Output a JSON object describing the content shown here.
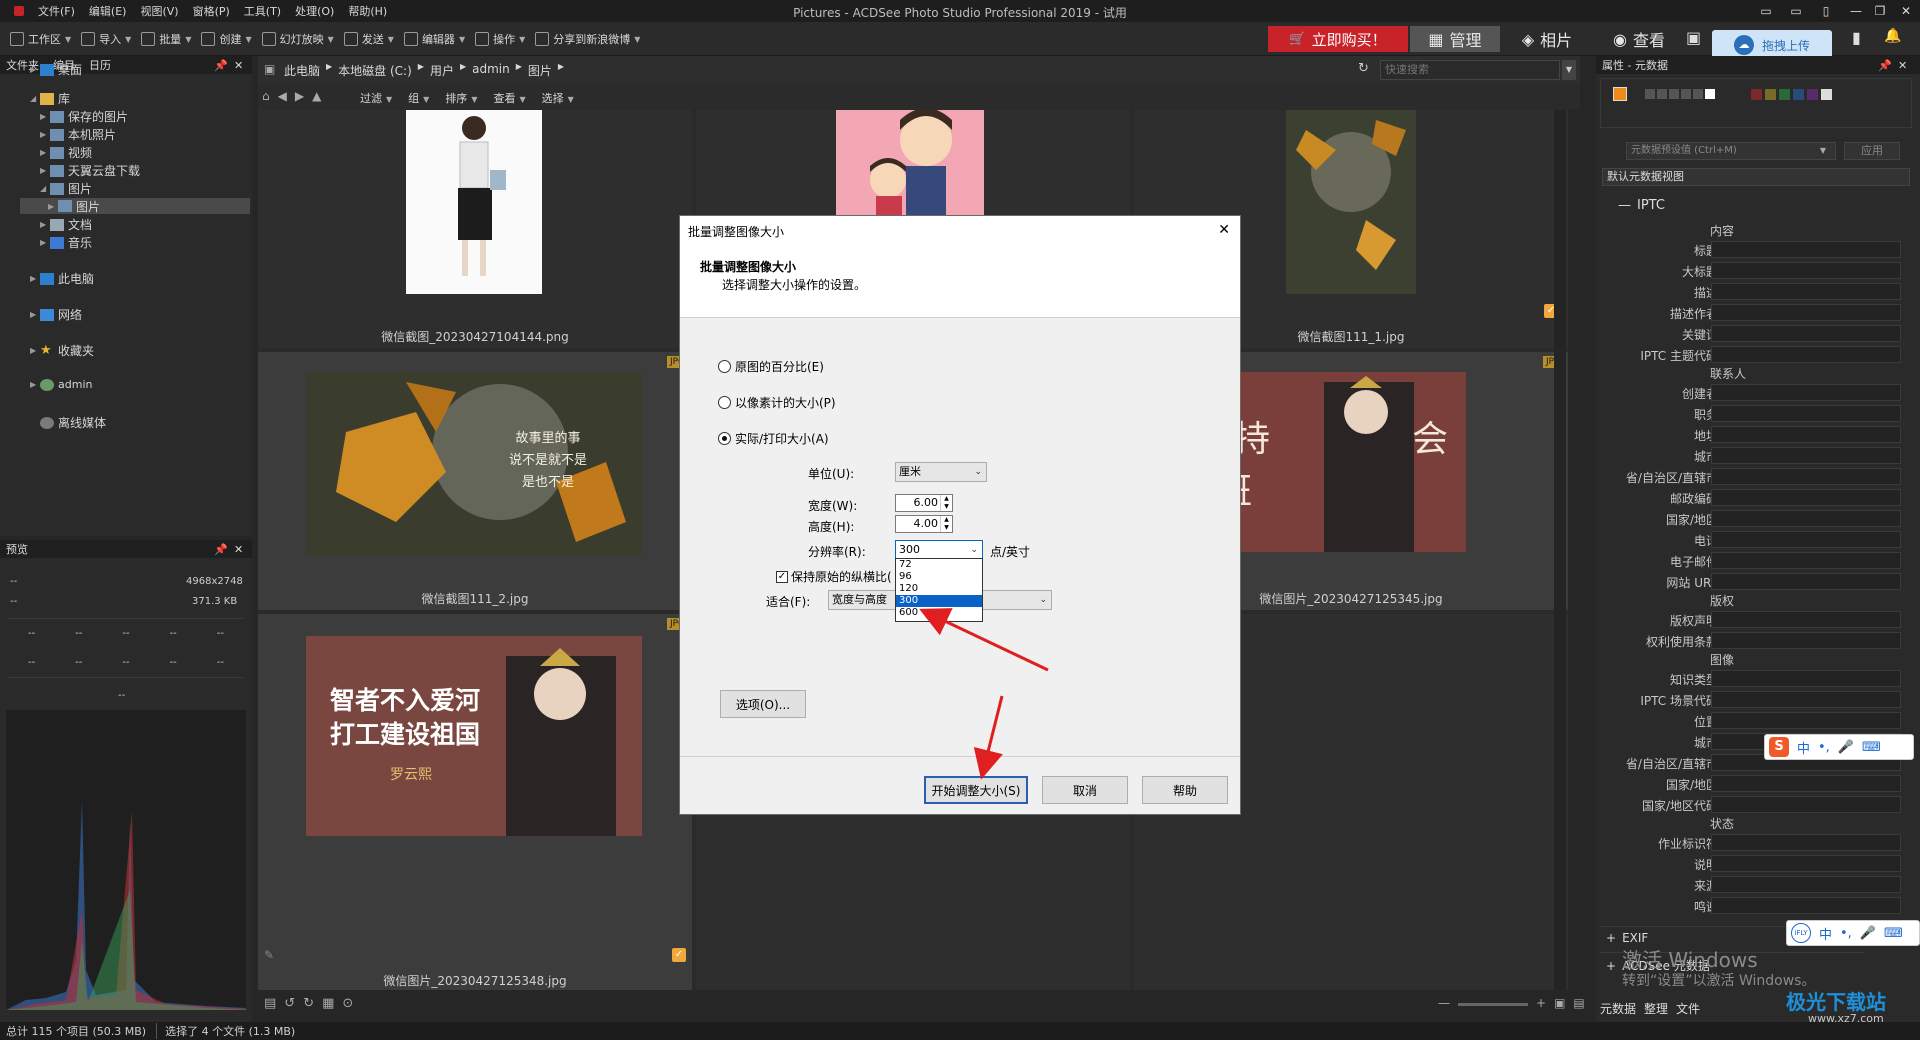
{
  "titlebar": {
    "menu": [
      "文件(F)",
      "编辑(E)",
      "视图(V)",
      "窗格(P)",
      "工具(T)",
      "处理(O)",
      "帮助(H)"
    ],
    "title": "Pictures - ACDSee Photo Studio Professional 2019 - 试用"
  },
  "toolbar": {
    "items": [
      "工作区",
      "导入",
      "批量",
      "创建",
      "幻灯放映",
      "发送",
      "编辑器",
      "操作",
      "分享到新浪微博"
    ],
    "buy": "立即购买！",
    "modes": {
      "manage": "管理",
      "photos": "相片",
      "view": "查看"
    },
    "cloud": "拖拽上传"
  },
  "folders": {
    "tabs": [
      "文件夹",
      "编目",
      "日历"
    ],
    "items": [
      "桌面",
      "库",
      "保存的图片",
      "本机照片",
      "视频",
      "天翼云盘下载",
      "图片",
      "图片",
      "文档",
      "音乐",
      "此电脑",
      "网络",
      "收藏夹",
      "admin",
      "离线媒体"
    ]
  },
  "preview": {
    "title": "预览",
    "resolution": "4968x2748",
    "size": "371.3 KB",
    "dash": "--"
  },
  "path": {
    "crumbs": [
      "此电脑",
      "本地磁盘 (C:)",
      "用户",
      "admin",
      "图片"
    ],
    "search_placeholder": "快速搜索"
  },
  "filterbar": {
    "items": [
      "过滤",
      "组",
      "排序",
      "查看",
      "选择"
    ]
  },
  "thumbs": [
    {
      "caption": "微信截图_20230427104144.png"
    },
    {
      "caption": ""
    },
    {
      "caption": "微信截图111_1.jpg"
    },
    {
      "caption": "微信截图111_2.jpg",
      "badge": "JPG"
    },
    {
      "caption": "微信图片_20230427125345.jpg",
      "badge": "JPG"
    },
    {
      "caption": "微信图片_20230427125348.jpg",
      "badge": "JPG"
    }
  ],
  "poster": {
    "l1": "智者不入爱河",
    "l2": "打工建设祖国",
    "l3": "罗云熙",
    "b1": "坚持",
    "b2": "会",
    "b3": "下班",
    "leaf1": "故事里的事",
    "leaf2": "说不是就不是",
    "leaf3": "是也不是"
  },
  "status": {
    "total": "总计 115 个项目 (50.3 MB)",
    "selected": "选择了 4 个文件 (1.3 MB)"
  },
  "props": {
    "title": "属性 - 元数据",
    "preset": "元数据预设值 (Ctrl+M)",
    "apply": "应用",
    "view": "默认元数据视图",
    "iptc": "IPTC",
    "sec_content": "内容",
    "content": [
      "标题",
      "大标题",
      "描述",
      "描述作者",
      "关键词",
      "IPTC 主题代码"
    ],
    "sec_contact": "联系人",
    "contact": [
      "创建者",
      "职务",
      "地址",
      "城市",
      "省/自治区/直辖市",
      "邮政编码",
      "国家/地区",
      "电话",
      "电子邮件",
      "网站 URL"
    ],
    "sec_rights": "版权",
    "rights": [
      "版权声明",
      "权利使用条款"
    ],
    "sec_image": "图像",
    "image": [
      "知识类型",
      "IPTC 场景代码",
      "位置",
      "城市",
      "省/自治区/直辖市",
      "国家/地区",
      "国家/地区代码"
    ],
    "sec_status": "状态",
    "status": [
      "作业标识符",
      "说明",
      "来源",
      "鸣谢"
    ],
    "exif": "EXIF",
    "acdsee": "ACDSee 元数据",
    "tabs": [
      "元数据",
      "整理",
      "文件"
    ]
  },
  "watermark": {
    "l1": "激活 Windows",
    "l2": "转到“设置”以激活 Windows。",
    "site": "极光下载站",
    "url": "www.xz7.com"
  },
  "dialog": {
    "title": "批量调整图像大小",
    "head_title": "批量调整图像大小",
    "head_sub": "选择调整大小操作的设置。",
    "opt_percent": "原图的百分比(E)",
    "opt_pixels": "以像素计的大小(P)",
    "opt_print": "实际/打印大小(A)",
    "unit_label": "单位(U):",
    "unit_value": "厘米",
    "width_label": "宽度(W):",
    "width_value": "6.00",
    "height_label": "高度(H):",
    "height_value": "4.00",
    "res_label": "分辨率(R):",
    "res_value": "300",
    "res_unit": "点/英寸",
    "keep_ratio": "保持原始的纵横比(",
    "fit_label": "适合(F):",
    "fit_value": "宽度与高度",
    "res_options": [
      "72",
      "96",
      "120",
      "300",
      "600"
    ],
    "options_btn": "选项(O)...",
    "start_btn": "开始调整大小(S)",
    "cancel_btn": "取消",
    "help_btn": "帮助"
  },
  "colors": {
    "accent_red": "#c9232a",
    "selection_blue": "#0a62c9",
    "orange_check": "#f2a73a"
  }
}
